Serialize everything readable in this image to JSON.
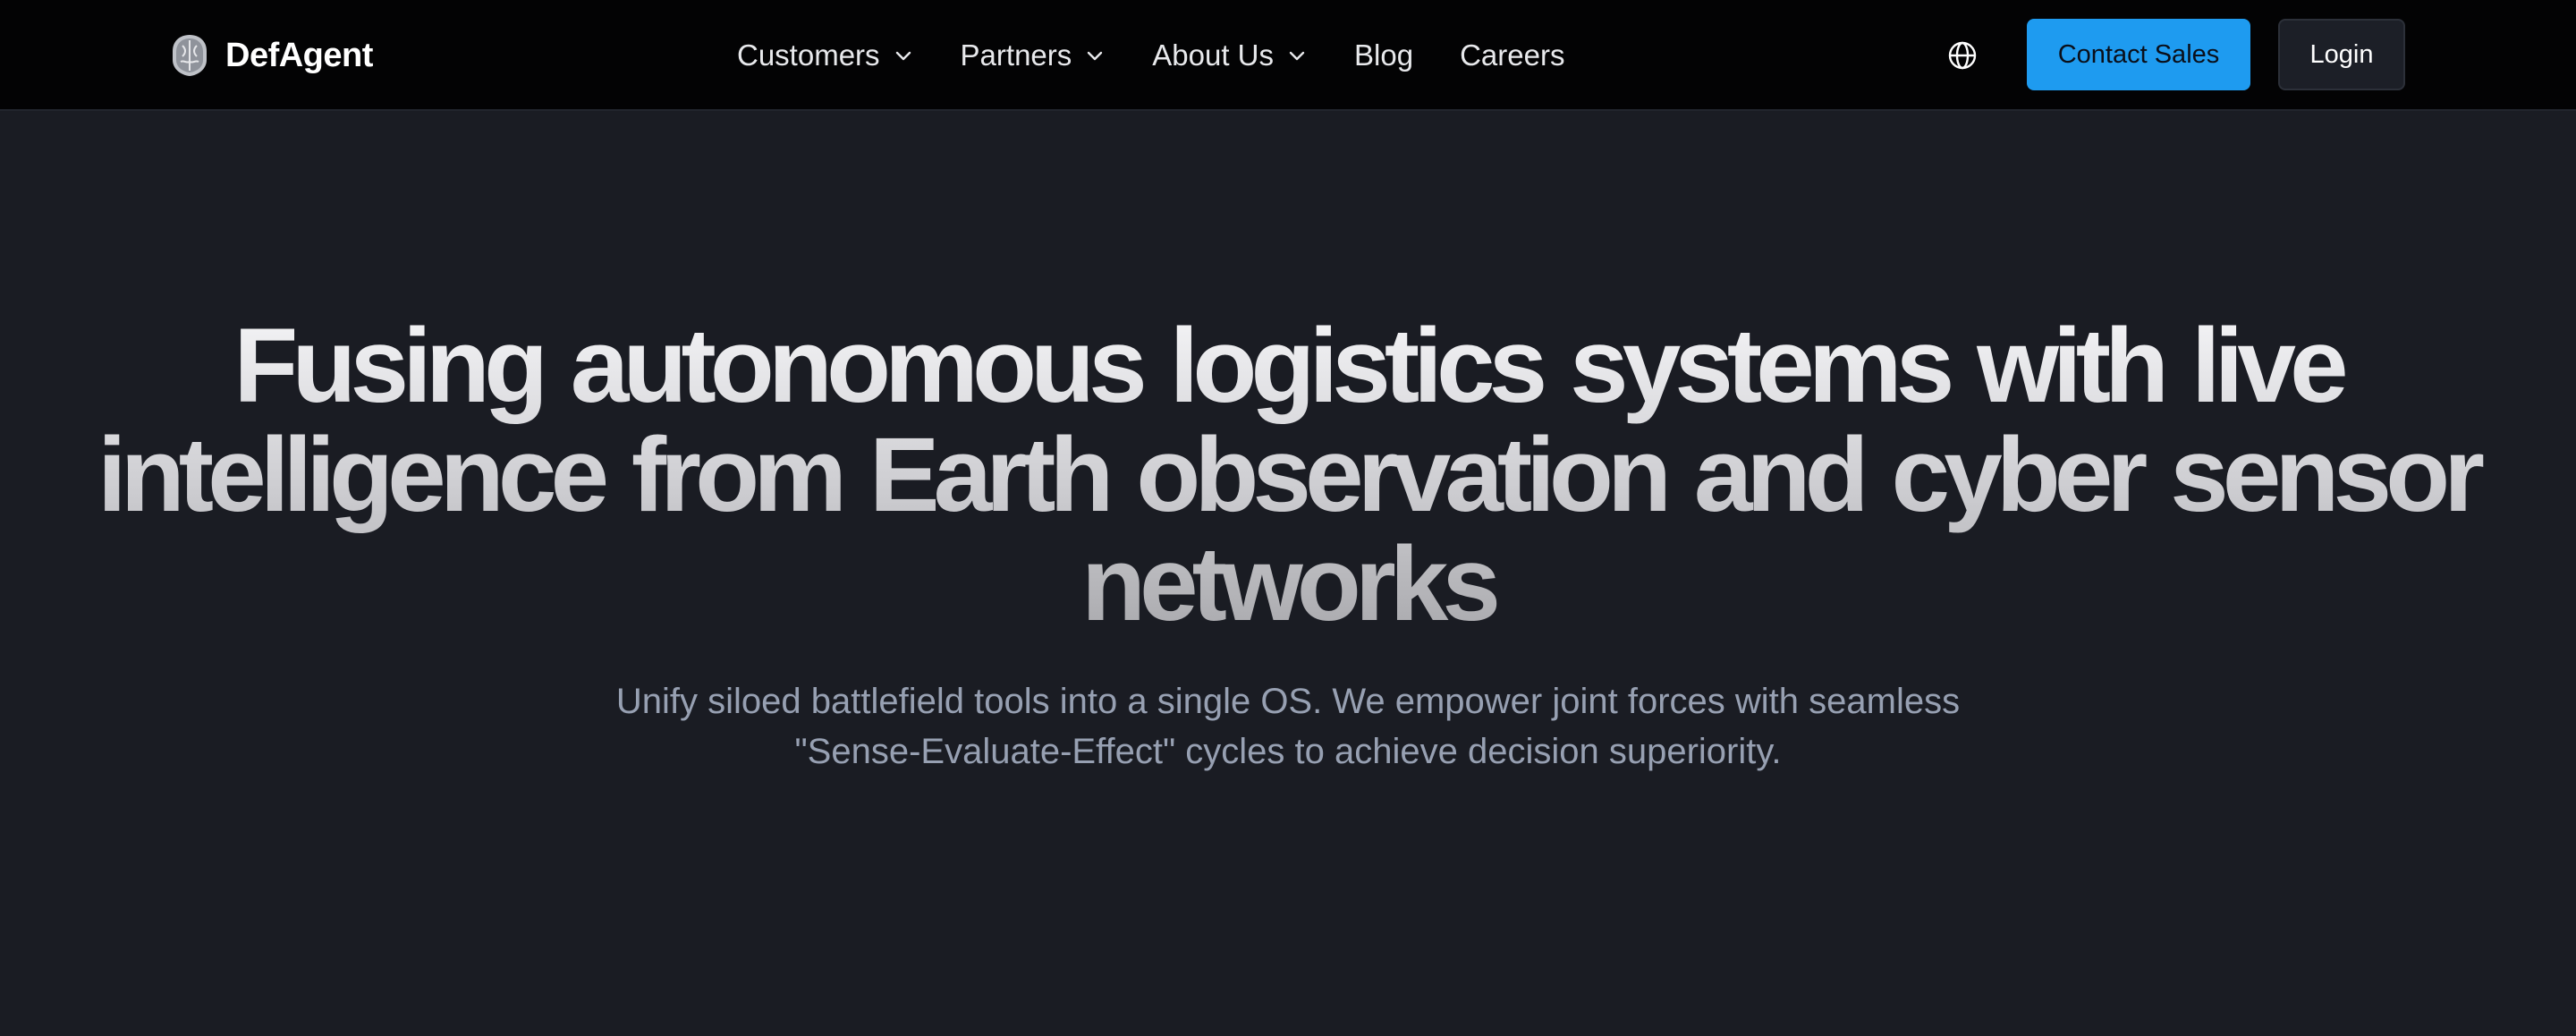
{
  "brand": {
    "name": "DefAgent",
    "logo_icon": "brain-shield-logo"
  },
  "nav": {
    "items": [
      {
        "label": "Customers",
        "has_dropdown": true
      },
      {
        "label": "Partners",
        "has_dropdown": true
      },
      {
        "label": "About Us",
        "has_dropdown": true
      },
      {
        "label": "Blog",
        "has_dropdown": false
      },
      {
        "label": "Careers",
        "has_dropdown": false
      }
    ],
    "language_icon": "globe-icon",
    "contact_label": "Contact Sales",
    "login_label": "Login"
  },
  "hero": {
    "title": "Fusing autonomous logistics systems with live intelligence from Earth observation and cyber sensor networks",
    "subtitle": "Unify siloed battlefield tools into a single OS. We empower joint forces with seamless \"Sense-Evaluate-Effect\" cycles to achieve decision superiority."
  },
  "colors": {
    "nav_background": "#030304",
    "page_background": "#1a1c23",
    "accent": "#1e9bf0",
    "login_background": "#1c1f27",
    "subtitle_text": "#97a0b2"
  }
}
